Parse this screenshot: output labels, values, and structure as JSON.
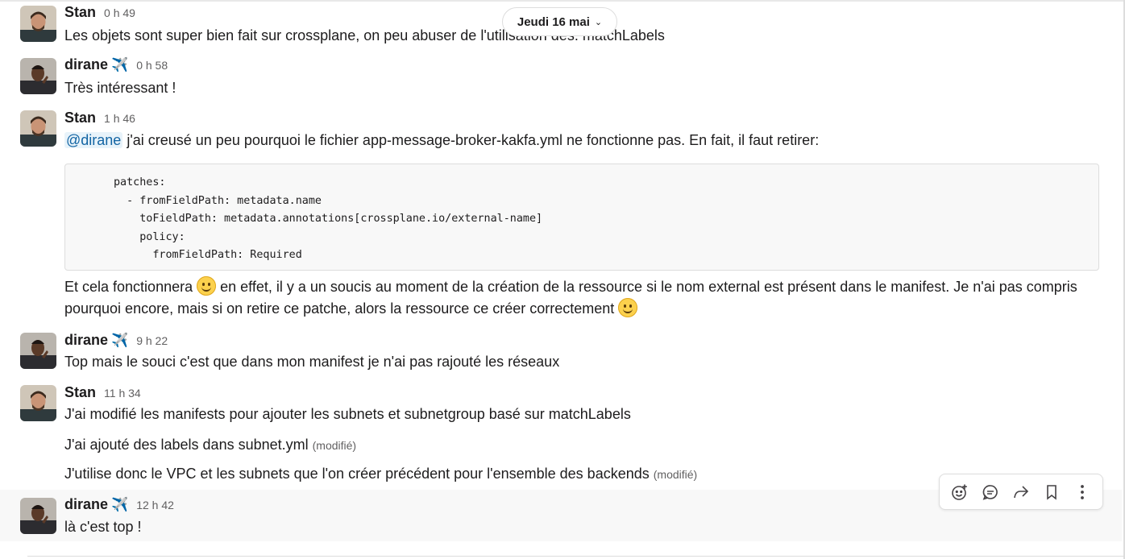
{
  "date_divider": {
    "label": "Jeudi 16 mai",
    "chevron": "chevron-down-icon"
  },
  "messages": [
    {
      "sender": "Stan",
      "time": "0 h 49",
      "text": "Les objets sont super bien fait sur crossplane, on peu abuser de l'utilisation des. matchLabels"
    },
    {
      "sender": "dirane",
      "status": "✈️",
      "time": "0 h 58",
      "text": "Très intéressant !"
    },
    {
      "sender": "Stan",
      "time": "1 h 46",
      "mention": "@dirane",
      "text": " j'ai creusé un peu pourquoi le fichier app-message-broker-kakfa.yml ne fonctionne pas. En fait, il faut retirer:",
      "code": "patches:\n  - fromFieldPath: metadata.name\n    toFieldPath: metadata.annotations[crossplane.io/external-name]\n    policy:\n      fromFieldPath: Required",
      "after_a": "Et cela fonctionnera ",
      "after_b": " en effet, il y a un soucis au moment de la création de la ressource si le nom external est présent dans le manifest. Je n'ai pas compris pourquoi encore, mais si on retire ce patche, alors la ressource ce créer correctement "
    },
    {
      "sender": "dirane",
      "status": "✈️",
      "time": "9 h 22",
      "text": "Top mais le souci c'est que dans mon manifest je n'ai pas rajouté les réseaux"
    },
    {
      "sender": "Stan",
      "time": "11 h 34",
      "text": "J'ai modifié les manifests pour ajouter les subnets et subnetgroup basé sur matchLabels",
      "followups": [
        {
          "text": "J'ai ajouté des labels dans subnet.yml",
          "edited": "(modifié)"
        },
        {
          "text": "J'utilise donc le VPC et les subnets que l'on créer précédent pour l'ensemble des backends",
          "edited": "(modifié)"
        }
      ]
    },
    {
      "sender": "dirane",
      "status": "✈️",
      "time": "12 h 42",
      "text": "là c'est top !"
    }
  ],
  "toolbar": {
    "icons": [
      "add-reaction-icon",
      "reply-thread-icon",
      "share-icon",
      "bookmark-icon",
      "more-actions-icon"
    ]
  },
  "colors": {
    "mention_bg": "#e8f3fa",
    "mention_fg": "#1264a3",
    "hover_bg": "#f8f8f8",
    "code_bg": "#f8f8f8"
  }
}
